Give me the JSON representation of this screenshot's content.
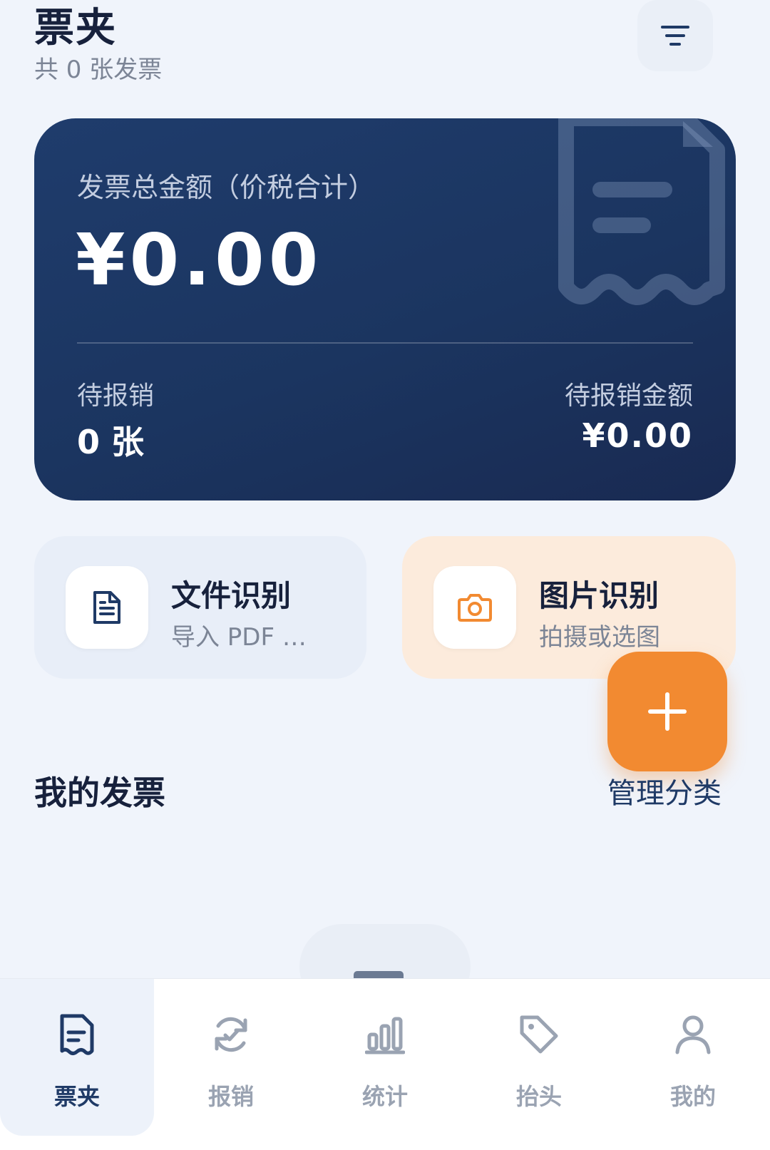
{
  "header": {
    "title": "票夹",
    "subtitle": "共 0 张发票",
    "filter_icon": "filter-icon"
  },
  "summary": {
    "label": "发票总金额（价税合计）",
    "total": "¥0.00",
    "pending_label": "待报销",
    "pending_count": "0 张",
    "pending_amount_label": "待报销金额",
    "pending_amount": "¥0.00",
    "watermark_icon": "receipt-icon"
  },
  "actions": {
    "file": {
      "title": "文件识别",
      "subtitle": "导入 PDF …",
      "icon": "document-icon"
    },
    "photo": {
      "title": "图片识别",
      "subtitle": "拍摄或选图",
      "icon": "camera-icon"
    }
  },
  "fab": {
    "icon": "plus-icon"
  },
  "section": {
    "title": "我的发票",
    "manage": "管理分类"
  },
  "nav": {
    "items": [
      {
        "label": "票夹",
        "icon": "invoice-icon",
        "active": true
      },
      {
        "label": "报销",
        "icon": "refresh-check-icon",
        "active": false
      },
      {
        "label": "统计",
        "icon": "bar-chart-icon",
        "active": false
      },
      {
        "label": "抬头",
        "icon": "tag-icon",
        "active": false
      },
      {
        "label": "我的",
        "icon": "user-icon",
        "active": false
      }
    ]
  },
  "colors": {
    "card": "#1f3c6c",
    "accent": "#f28a31",
    "nav_active": "#1f3a66",
    "nav_inactive": "#9aa3b2"
  }
}
